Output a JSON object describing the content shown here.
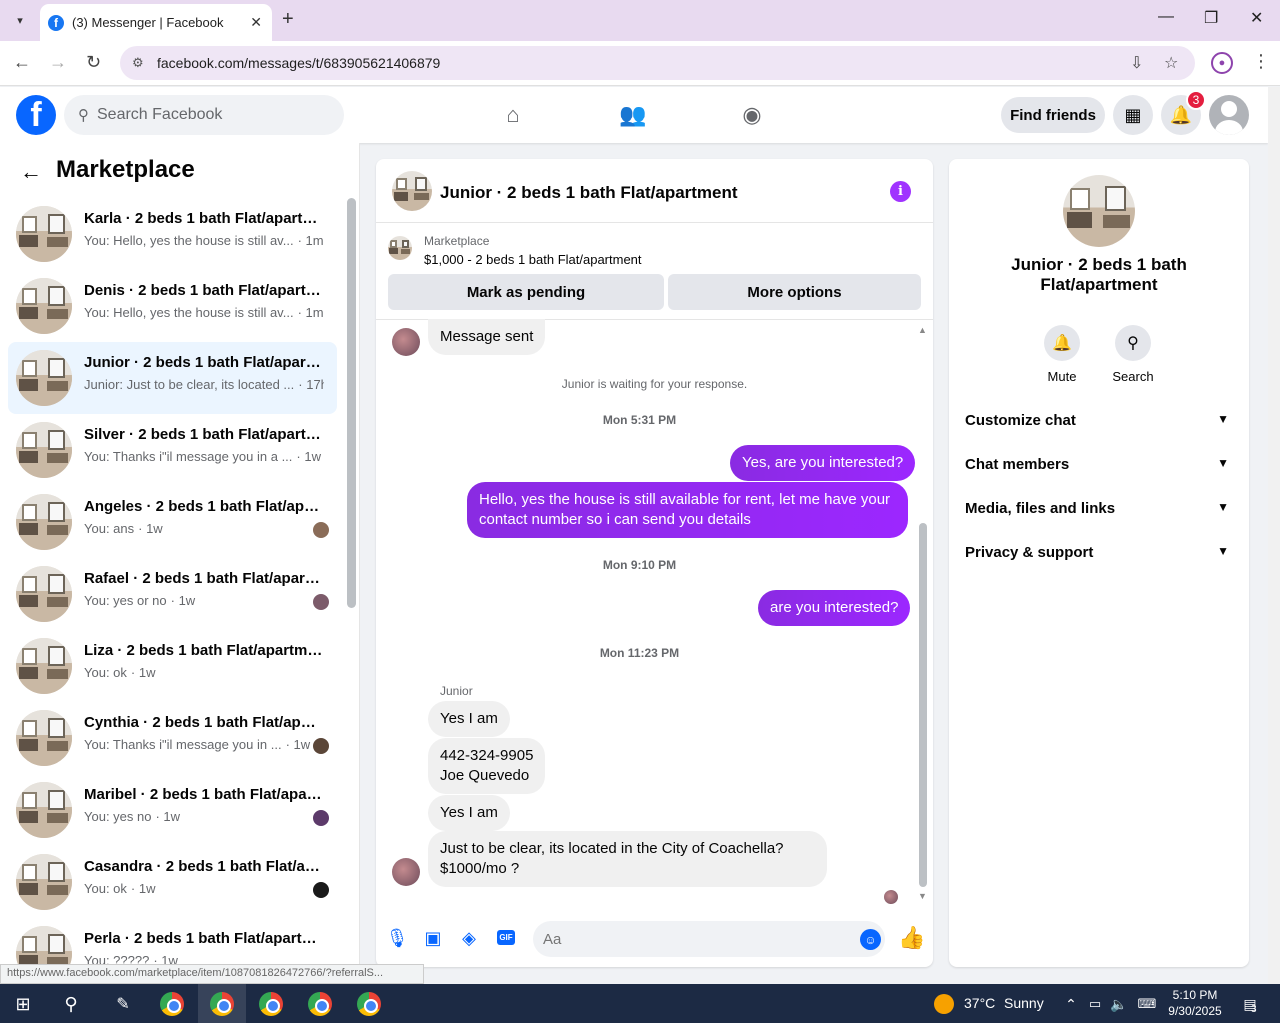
{
  "browser": {
    "tab_title": "(3) Messenger | Facebook",
    "url": "facebook.com/messages/t/683905621406879",
    "status_url": "https://www.facebook.com/marketplace/item/1087081826472766/?referralS..."
  },
  "fb_header": {
    "search_placeholder": "Search Facebook",
    "find_friends": "Find friends",
    "notification_count": "3"
  },
  "left_panel": {
    "title": "Marketplace",
    "conversations": [
      {
        "name": "Karla · 2 beds 1 bath Flat/apartment",
        "preview": "You: Hello, yes the house is still av...",
        "time": "· 1m",
        "active": false
      },
      {
        "name": "Denis · 2 beds 1 bath Flat/apartment",
        "preview": "You: Hello, yes the house is still av...",
        "time": "· 1m",
        "active": false
      },
      {
        "name": "Junior · 2 beds 1 bath Flat/apartment",
        "preview": "Junior: Just to be clear, its located ...",
        "time": "· 17h",
        "active": true
      },
      {
        "name": "Silver · 2 beds 1 bath Flat/apartment",
        "preview": "You: Thanks i\"il message you in a ...",
        "time": "· 1w",
        "active": false
      },
      {
        "name": "Angeles · 2 beds 1 bath Flat/apartment",
        "preview": "You: ans",
        "time": "· 1w",
        "active": false
      },
      {
        "name": "Rafael · 2 beds 1 bath Flat/apartment",
        "preview": "You: yes or no",
        "time": "· 1w",
        "active": false
      },
      {
        "name": "Liza · 2 beds 1 bath Flat/apartment",
        "preview": "You: ok",
        "time": "· 1w",
        "active": false
      },
      {
        "name": "Cynthia · 2 beds 1 bath Flat/apartment",
        "preview": "You: Thanks i\"il message you in ...",
        "time": "· 1w",
        "active": false
      },
      {
        "name": "Maribel · 2 beds 1 bath Flat/apartment",
        "preview": "You: yes no",
        "time": "· 1w",
        "active": false
      },
      {
        "name": "Casandra · 2 beds 1 bath Flat/apartment",
        "preview": "You: ok",
        "time": "· 1w",
        "active": false
      },
      {
        "name": "Perla · 2 beds 1 bath Flat/apartment",
        "preview": "You: ?????",
        "time": "· 1w",
        "active": false
      }
    ]
  },
  "chat": {
    "title": "Junior · 2 beds 1 bath Flat/apartment",
    "marketplace_label": "Marketplace",
    "listing": "$1,000 - 2 beds 1 bath Flat/apartment",
    "mark_pending": "Mark as pending",
    "more_options": "More options",
    "msg_sent": "Message sent",
    "waiting": "Junior is waiting for your response.",
    "ts1": "Mon 5:31 PM",
    "out1": "Yes, are you interested?",
    "out2": "Hello, yes the house is still available for rent, let me have your contact number so i can send you details",
    "ts2": "Mon 9:10 PM",
    "out3": "are you interested?",
    "ts3": "Mon 11:23 PM",
    "sender": "Junior",
    "in1": "Yes I am",
    "in2a": "442-324-9905",
    "in2b": "Joe Quevedo",
    "in3": "Yes I am",
    "in4a": "Just to be clear, its located in the City of Coachella?",
    "in4b": "$1000/mo ?",
    "composer_placeholder": "Aa"
  },
  "right_panel": {
    "title": "Junior · 2 beds 1 bath Flat/apartment",
    "mute": "Mute",
    "search": "Search",
    "sections": [
      "Customize chat",
      "Chat members",
      "Media, files and links",
      "Privacy & support"
    ]
  },
  "taskbar": {
    "temperature": "37°C",
    "weather": "Sunny",
    "time": "5:10 PM",
    "date": "9/30/2025",
    "notifications": "3"
  },
  "colors": {
    "accent": "#a033ff",
    "fb_blue": "#0866ff"
  }
}
